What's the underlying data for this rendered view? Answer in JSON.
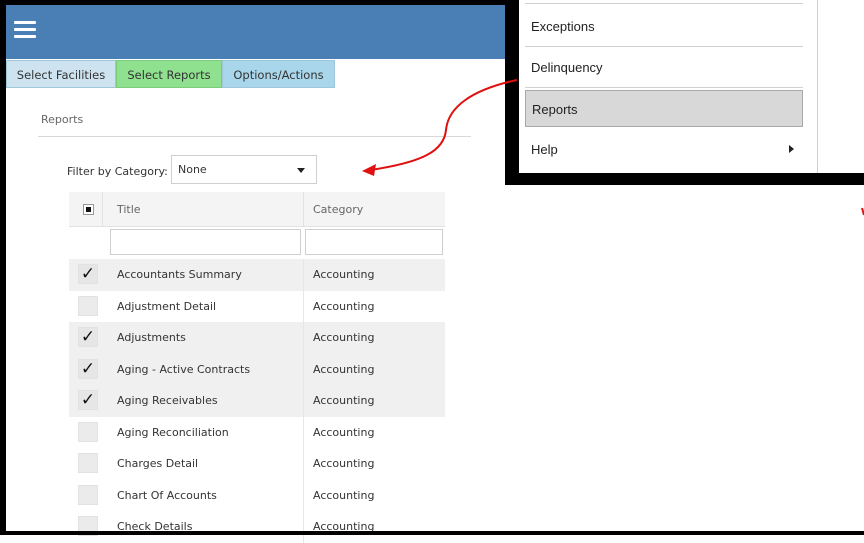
{
  "tabs": {
    "facilities": "Select Facilities",
    "reports": "Select Reports",
    "options": "Options/Actions"
  },
  "section_label": "Reports",
  "filter": {
    "label": "Filter by Category:",
    "value": "None"
  },
  "grid": {
    "columns": {
      "title": "Title",
      "category": "Category"
    },
    "rows": [
      {
        "title": "Accountants Summary",
        "category": "Accounting",
        "checked": true
      },
      {
        "title": "Adjustment Detail",
        "category": "Accounting",
        "checked": false
      },
      {
        "title": "Adjustments",
        "category": "Accounting",
        "checked": true
      },
      {
        "title": "Aging - Active Contracts",
        "category": "Accounting",
        "checked": true
      },
      {
        "title": "Aging Receivables",
        "category": "Accounting",
        "checked": true
      },
      {
        "title": "Aging Reconciliation",
        "category": "Accounting",
        "checked": false
      },
      {
        "title": "Charges Detail",
        "category": "Accounting",
        "checked": false
      },
      {
        "title": "Chart Of Accounts",
        "category": "Accounting",
        "checked": false
      },
      {
        "title": "Check Details",
        "category": "Accounting",
        "checked": false
      }
    ],
    "check_glyph": "✓"
  },
  "menu": {
    "items": {
      "exceptions": "Exceptions",
      "delinquency": "Delinquency",
      "reports": "Reports",
      "help": "Help"
    }
  },
  "colors": {
    "topbar": "#4a7fb5",
    "tab_reports": "#8fe08f",
    "tab_options": "#a9d6ea",
    "annotation_arrow": "#e01010"
  }
}
